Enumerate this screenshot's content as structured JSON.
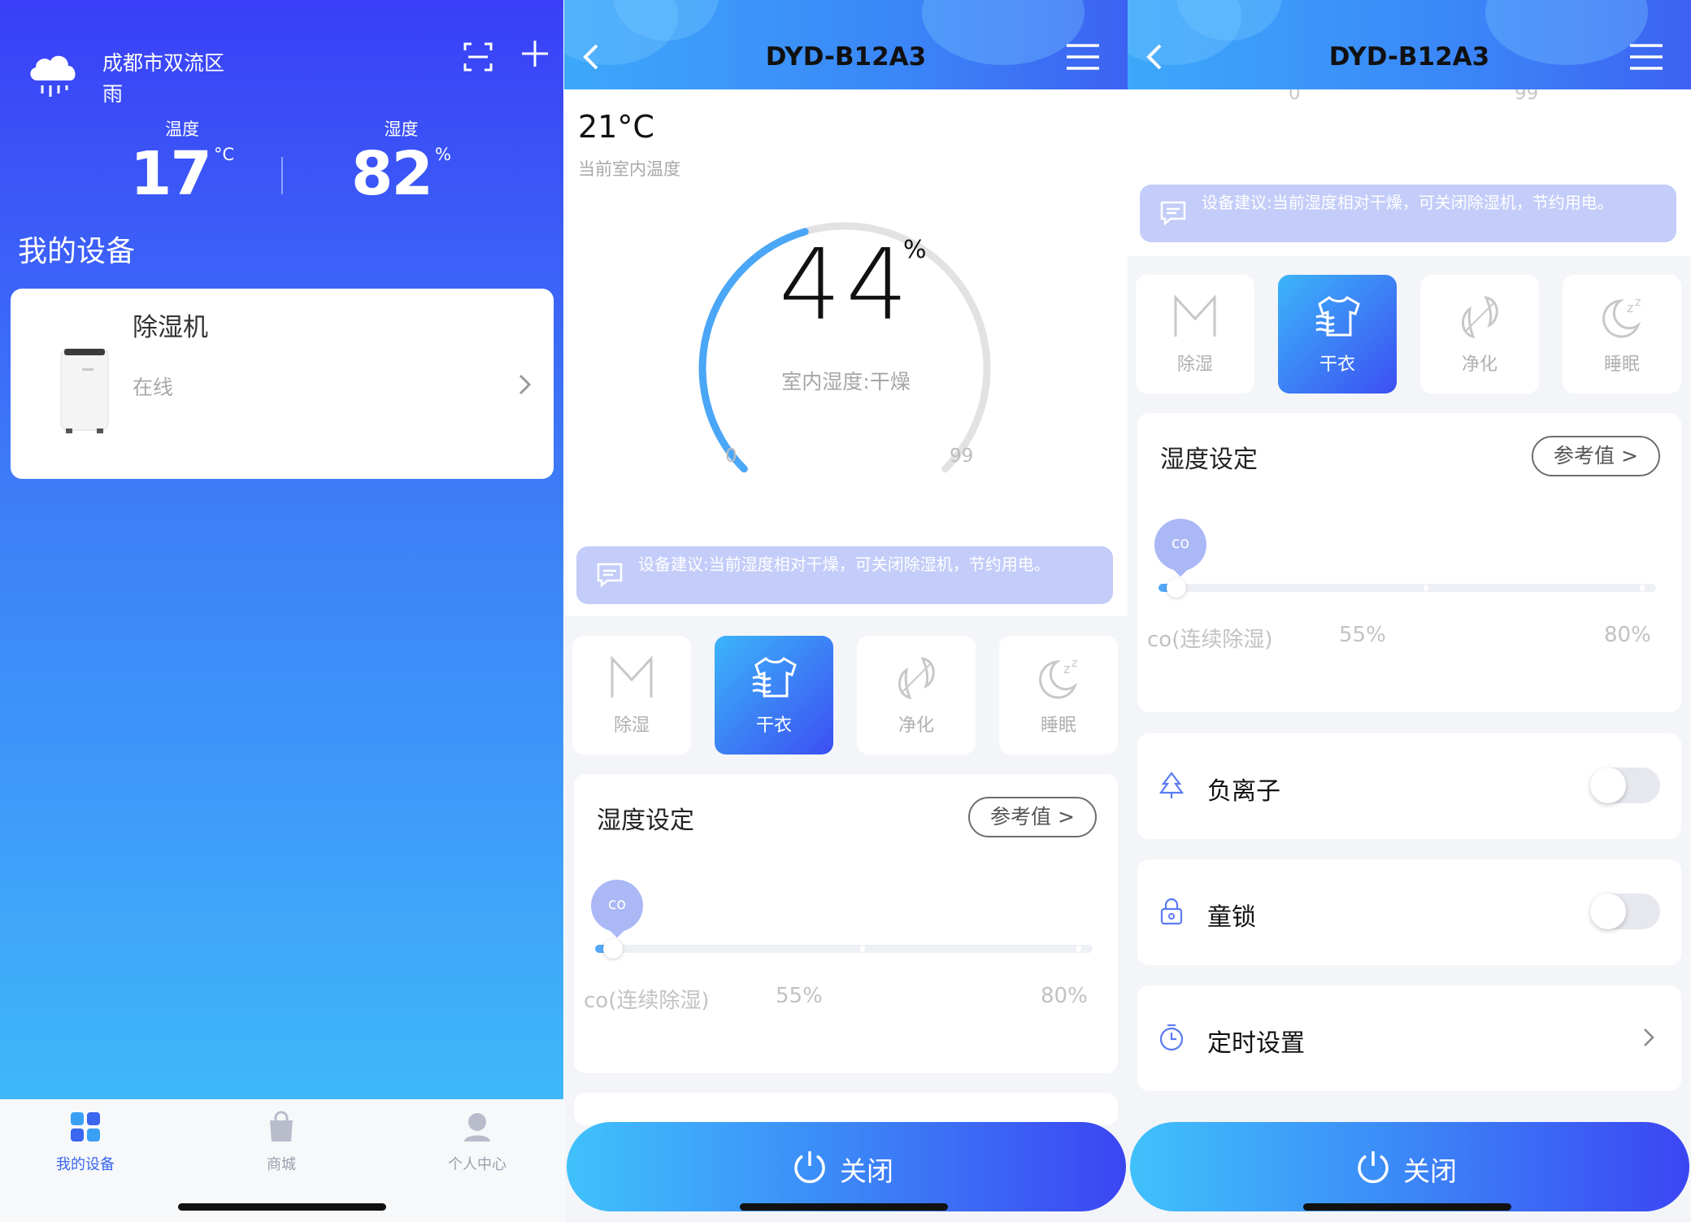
{
  "home": {
    "location": "成都市双流区",
    "weather": "雨",
    "temperature": {
      "label": "温度",
      "value": "17",
      "unit": "°C"
    },
    "humidity": {
      "label": "湿度",
      "value": "82",
      "unit": "%"
    },
    "section_title": "我的设备",
    "devices": [
      {
        "name": "除湿机",
        "status": "在线"
      }
    ],
    "tabs": [
      {
        "label": "我的设备",
        "active": true
      },
      {
        "label": "商城",
        "active": false
      },
      {
        "label": "个人中心",
        "active": false
      }
    ]
  },
  "detail": {
    "title": "DYD-B12A3",
    "current_temp": "21°C",
    "current_temp_label": "当前室内温度",
    "gauge": {
      "value": "44",
      "unit": "%",
      "status": "室内湿度:干燥",
      "min": "0",
      "max": "99",
      "level": 0.44
    },
    "advice": "设备建议:当前湿度相对干燥，可关闭除湿机，节约用电。",
    "modes": [
      {
        "label": "除湿",
        "icon": "m-letter-icon",
        "active": false
      },
      {
        "label": "干衣",
        "icon": "shirt-icon",
        "active": true
      },
      {
        "label": "净化",
        "icon": "leaf-icon",
        "active": false
      },
      {
        "label": "睡眠",
        "icon": "moon-zz-icon",
        "active": false
      }
    ],
    "humidity_setting": {
      "title": "湿度设定",
      "reference_button": "参考值 >",
      "bubble": "co",
      "scale": [
        "co(连续除湿)",
        "55%",
        "80%"
      ]
    },
    "features": [
      {
        "label": "负离子",
        "icon": "tree-icon",
        "enabled": false
      },
      {
        "label": "童锁",
        "icon": "lock-icon",
        "enabled": false
      },
      {
        "label": "定时设置",
        "icon": "timer-icon"
      }
    ],
    "power_button": "关闭",
    "scrolled_axis": {
      "min": "0",
      "max": "99"
    }
  },
  "colors": {
    "primary_blue": "#3a3ff7",
    "cyan": "#40c3fb",
    "gauge_arc": "#4aa6f7",
    "advice_bg": "#c4cdf9"
  }
}
